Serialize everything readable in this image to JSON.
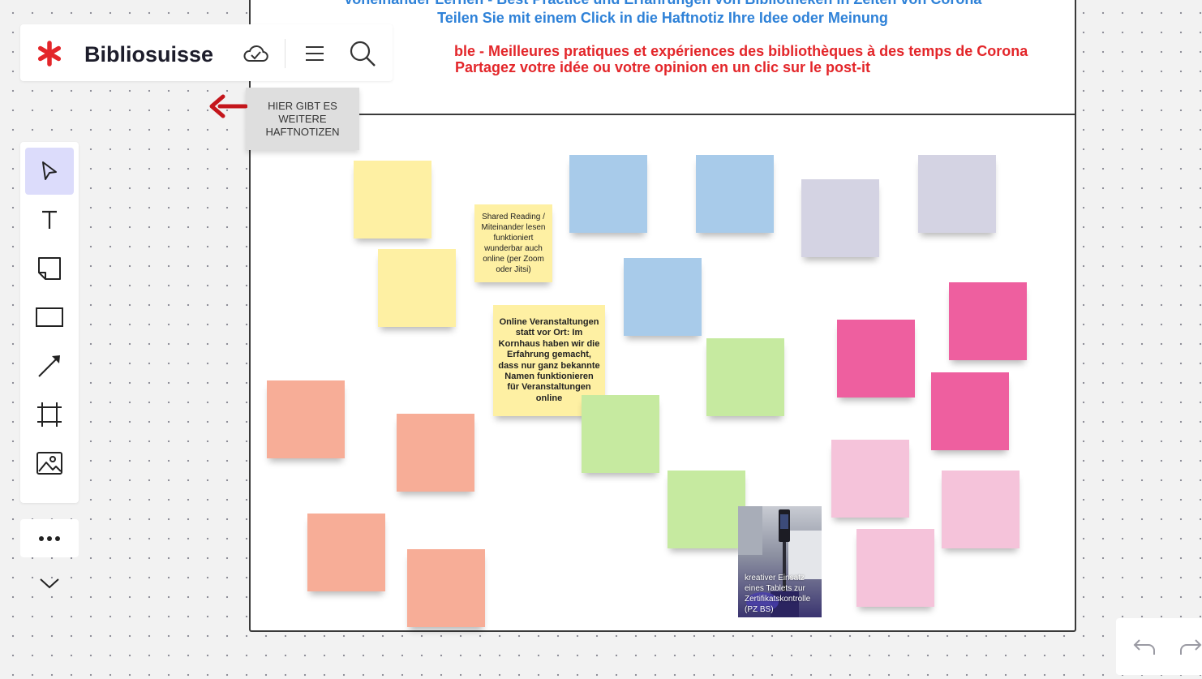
{
  "header": {
    "line_de_cut": "Voneinander Lernen - Best Practice und Erfahrungen von Bibliotheken in Zeiten von Corona",
    "line_de": "Teilen Sie mit einem Click in die Haftnotiz Ihre Idee oder Meinung",
    "line_fr": "ble - Meilleures pratiques et expériences des bibliothèques à des temps de Corona",
    "line_fr2": "Partagez votre idée ou votre opinion en un clic sur le post-it"
  },
  "topbar": {
    "title": "Bibliosuisse",
    "icons": [
      "logo-asterisk-icon",
      "cloud-sync-icon",
      "menu-icon",
      "search-icon"
    ]
  },
  "tools": [
    {
      "name": "select-tool",
      "icon": "cursor-icon",
      "active": true
    },
    {
      "name": "text-tool",
      "icon": "text-icon",
      "active": false
    },
    {
      "name": "sticky-note-tool",
      "icon": "sticky-note-icon",
      "active": false
    },
    {
      "name": "shape-tool",
      "icon": "rectangle-icon",
      "active": false
    },
    {
      "name": "line-tool",
      "icon": "arrow-line-icon",
      "active": false
    },
    {
      "name": "frame-tool",
      "icon": "frame-icon",
      "active": false
    },
    {
      "name": "image-tool",
      "icon": "image-icon",
      "active": false
    }
  ],
  "hint_note": {
    "text": "HIER GIBT ES WEITERE HAFTNOTIZEN"
  },
  "notes": {
    "shared_reading": "Shared Reading / Miteinander lesen funktioniert wunderbar auch online (per Zoom oder Jitsi)",
    "online_events": "Online Veranstaltungen statt vor Ort: Im Kornhaus haben wir die Erfahrung gemacht, dass nur ganz bekannte Namen funktionieren für Veranstaltungen online"
  },
  "photo": {
    "caption": "kreativer Einsatz eines Tablets zur Zertifikatskontrolle (PZ BS)"
  },
  "colors": {
    "yellow": "#fef0a3",
    "blue": "#a8cbea",
    "lavender": "#d4d3e3",
    "green": "#c6eaa0",
    "salmon": "#f7ad97",
    "magenta": "#ee5f9f",
    "pink": "#f5c3da",
    "header_blue": "#2f82d8",
    "header_red": "#e3262a",
    "accent_red": "#e3262a",
    "active_tool": "#dcdcfb"
  }
}
